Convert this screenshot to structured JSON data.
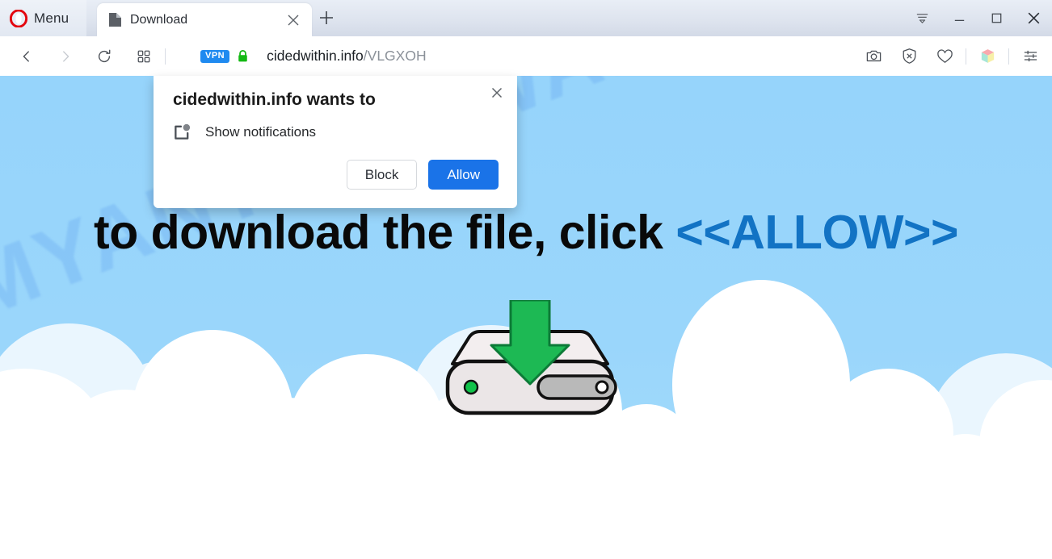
{
  "browser": {
    "name": "Opera",
    "menu_label": "Menu",
    "logo_color": "#e3060f",
    "tab": {
      "title": "Download",
      "favicon": "document-icon",
      "close_icon": "close-icon"
    },
    "new_tab_icon": "plus-icon",
    "window_controls": [
      {
        "name": "tab-list-icon",
        "glyph": "tab-list"
      },
      {
        "name": "minimize-icon",
        "glyph": "minimize"
      },
      {
        "name": "maximize-icon",
        "glyph": "maximize"
      },
      {
        "name": "close-icon",
        "glyph": "close"
      }
    ],
    "toolbar": {
      "left_icons": [
        {
          "name": "back-icon"
        },
        {
          "name": "forward-icon"
        },
        {
          "name": "reload-icon"
        },
        {
          "name": "speed-dial-icon"
        }
      ],
      "vpn_badge": "VPN",
      "lock_icon": "padlock-icon",
      "lock_color": "#14b914",
      "url_host": "cidedwithin.info",
      "url_path": "/VLGXOH",
      "right_icons": [
        {
          "name": "snapshot-camera-icon"
        },
        {
          "name": "ad-blocker-shield-icon"
        },
        {
          "name": "heart-icon"
        },
        {
          "name": "extensions-cube-icon"
        },
        {
          "name": "easy-setup-sliders-icon"
        }
      ]
    }
  },
  "dialog": {
    "title": "cidedwithin.info wants to",
    "permission_label": "Show notifications",
    "permission_icon": "notification-badge-icon",
    "close_icon": "close-icon",
    "block_label": "Block",
    "allow_label": "Allow",
    "allow_color": "#1a73e8"
  },
  "page": {
    "headline_text": "to download the file, click ",
    "headline_allow": "<<ALLOW>>",
    "headline_allow_color": "#1273c4",
    "watermark": "MYANTISPYWARE.COM",
    "sky_color": "#97d5fa",
    "illustration": {
      "name": "download-to-drive-illustration",
      "arrow_color": "#1db954",
      "drive_color": "#f0ebec",
      "led_color": "#11c24a"
    }
  }
}
